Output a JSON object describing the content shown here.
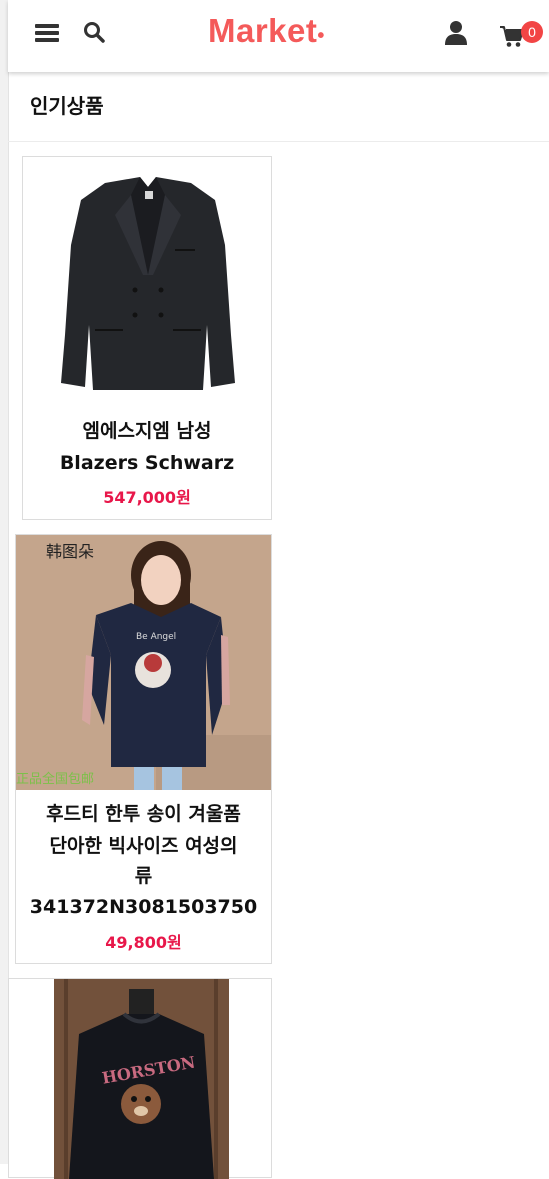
{
  "header": {
    "logo_text": "Market",
    "logo_dot": "•",
    "cart_count": "0",
    "icons": [
      "menu-icon",
      "search-icon",
      "user-icon",
      "cart-icon"
    ],
    "brand_color": "#f45a5a"
  },
  "section": {
    "title": "인기상품"
  },
  "products": [
    {
      "name_line1": "엠에스지엠 남성",
      "name_line2": "Blazers Schwarz",
      "price": "547,000원"
    },
    {
      "name_line1": "후드티 한투 송이 겨울폼",
      "name_line2": "단아한 빅사이즈 여성의",
      "name_line3": "류",
      "name_line4": "341372N3081503750",
      "price": "49,800원",
      "image_text_top": "韩图朵",
      "image_text_bottom": "正品全国包邮"
    },
    {
      "name_line1": "",
      "image_text": "HORSTON"
    }
  ],
  "colors": {
    "price": "#e8174a",
    "badge": "#f24545"
  }
}
